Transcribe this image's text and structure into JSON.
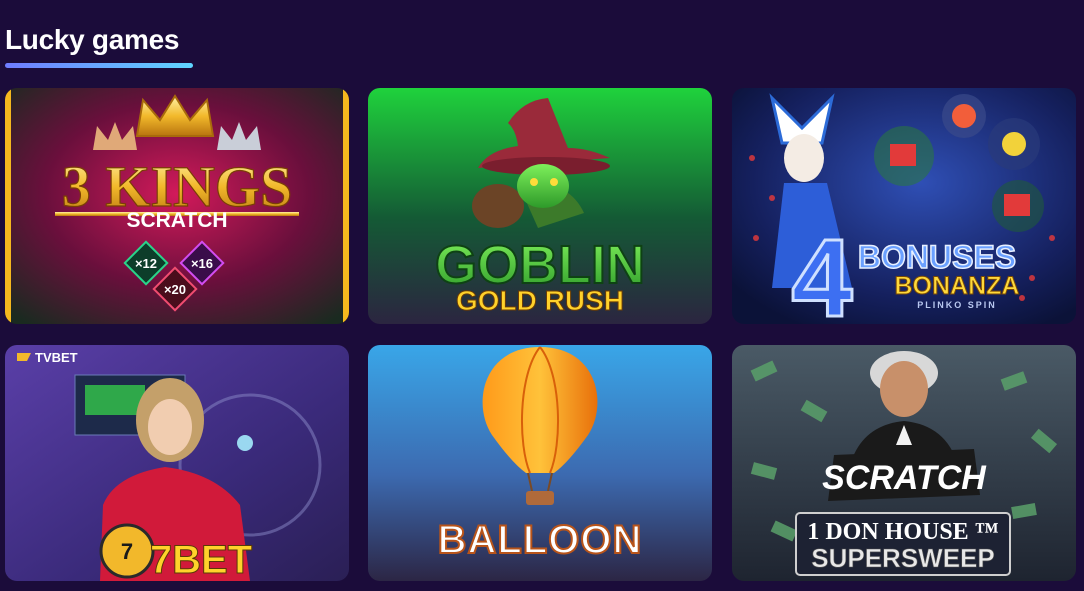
{
  "section": {
    "title": "Lucky games"
  },
  "games": [
    {
      "id": "3kings",
      "title_line1": "3 KINGS",
      "title_line2": "SCRATCH",
      "multipliers": [
        "×12",
        "×16",
        "×20"
      ]
    },
    {
      "id": "goblin",
      "title_line1": "GOBLIN",
      "title_line2": "GOLD RUSH"
    },
    {
      "id": "bonanza",
      "title_num": "4",
      "title_line1": "BONUSES",
      "title_line2": "BONANZA",
      "subtitle": "PLINKO SPIN"
    },
    {
      "id": "7bet",
      "provider": "TVBET",
      "title_line1": "7BET"
    },
    {
      "id": "balloon",
      "title_line1": "BALLOON"
    },
    {
      "id": "donhouse",
      "badge": "SCRATCH",
      "title_line1": "1 DON HOUSE ™",
      "title_line2": "SUPERSWEEP"
    }
  ],
  "colors": {
    "page_bg": "#1b0c3a",
    "underline_start": "#6f7cff",
    "underline_end": "#5fd6ff"
  }
}
